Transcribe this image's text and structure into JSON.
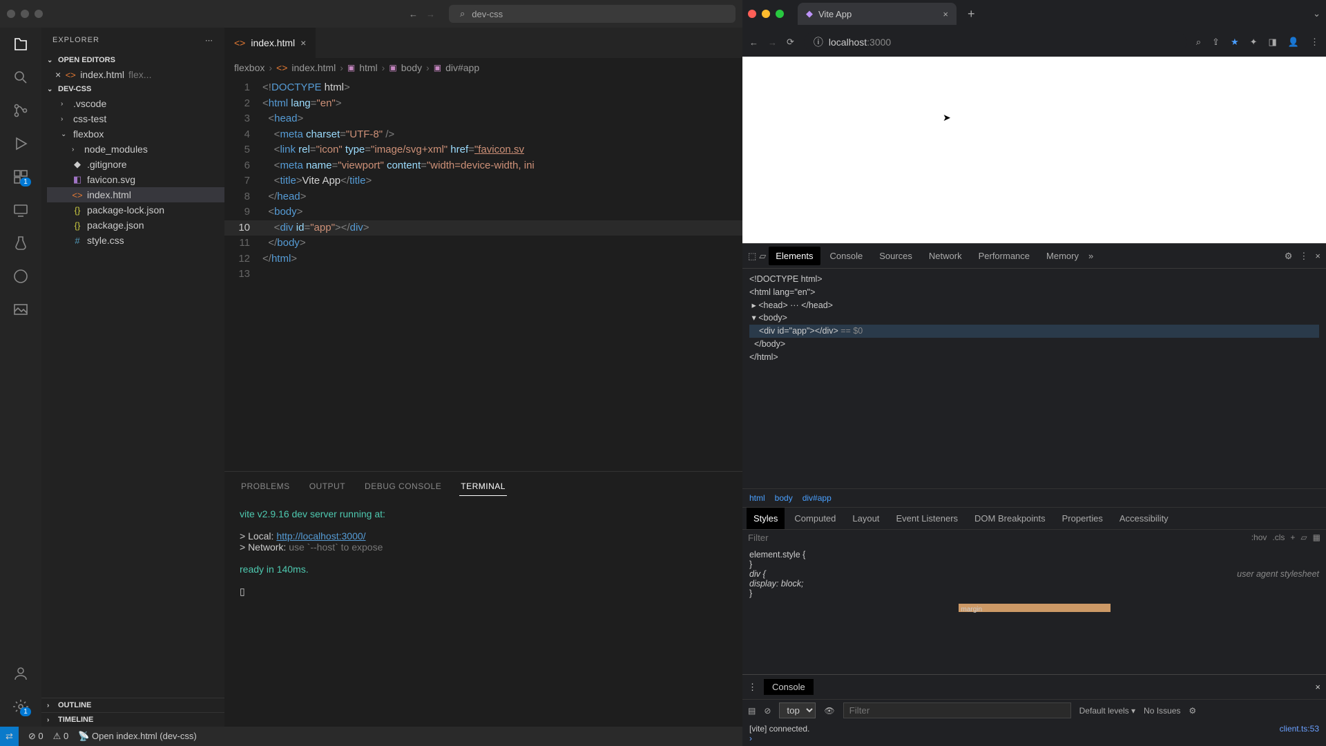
{
  "vscode": {
    "search_text": "dev-css",
    "explorer_title": "EXPLORER",
    "sections": {
      "open_editors": "OPEN EDITORS",
      "workspace": "DEV-CSS",
      "outline": "OUTLINE",
      "timeline": "TIMELINE"
    },
    "open_editor_file": "index.html",
    "open_editor_hint": "flex...",
    "tree": {
      "vscode_dir": ".vscode",
      "css_test": "css-test",
      "flexbox": "flexbox",
      "node_modules": "node_modules",
      "gitignore": ".gitignore",
      "favicon": "favicon.svg",
      "index": "index.html",
      "pkg_lock": "package-lock.json",
      "pkg": "package.json",
      "style": "style.css"
    },
    "tab_file": "index.html",
    "breadcrumb": {
      "a": "flexbox",
      "b": "index.html",
      "c": "html",
      "d": "body",
      "e": "div#app"
    },
    "code": {
      "l1a": "<!",
      "l1b": "DOCTYPE",
      "l1c": " html",
      "l1d": ">",
      "l2a": "<",
      "l2b": "html",
      "l2c": " lang",
      "l2d": "=",
      "l2e": "\"en\"",
      "l2f": ">",
      "l3a": "<",
      "l3b": "head",
      "l3c": ">",
      "l4a": "<",
      "l4b": "meta",
      "l4c": " charset",
      "l4d": "=",
      "l4e": "\"UTF-8\"",
      "l4f": " />",
      "l5a": "<",
      "l5b": "link",
      "l5c": " rel",
      "l5d": "=",
      "l5e": "\"icon\"",
      "l5f": " type",
      "l5g": "=",
      "l5h": "\"image/svg+xml\"",
      "l5i": " href",
      "l5j": "=",
      "l5k": "\"favicon.sv",
      "l6a": "<",
      "l6b": "meta",
      "l6c": " name",
      "l6d": "=",
      "l6e": "\"viewport\"",
      "l6f": " content",
      "l6g": "=",
      "l6h": "\"width=device-width, ini",
      "l7a": "<",
      "l7b": "title",
      "l7c": ">",
      "l7d": "Vite App",
      "l7e": "</",
      "l7f": "title",
      "l7g": ">",
      "l8a": "</",
      "l8b": "head",
      "l8c": ">",
      "l9a": "<",
      "l9b": "body",
      "l9c": ">",
      "l10a": "<",
      "l10b": "div",
      "l10c": " id",
      "l10d": "=",
      "l10e": "\"app\"",
      "l10f": "></",
      "l10g": "div",
      "l10h": ">",
      "l11a": "</",
      "l11b": "body",
      "l11c": ">",
      "l12a": "</",
      "l12b": "html",
      "l12c": ">"
    },
    "gutter": {
      "l1": "1",
      "l2": "2",
      "l3": "3",
      "l4": "4",
      "l5": "5",
      "l6": "6",
      "l7": "7",
      "l8": "8",
      "l9": "9",
      "l10": "10",
      "l11": "11",
      "l12": "12",
      "l13": "13"
    },
    "panel_tabs": {
      "problems": "PROBLEMS",
      "output": "OUTPUT",
      "debug": "DEBUG CONSOLE",
      "terminal": "TERMINAL"
    },
    "terminal": {
      "line1": "vite v2.9.16 dev server running at:",
      "local_label": "> Local:   ",
      "local_url": "http://localhost:3000/",
      "network": "> Network: ",
      "network_hint": "use `--host` to expose",
      "ready": "ready in 140ms.",
      "cursor": "▯"
    },
    "status": {
      "errors": "0",
      "warnings": "0",
      "live": "Open index.html (dev-css)"
    },
    "badge": "1"
  },
  "chrome": {
    "tab_title": "Vite App",
    "url_host": "localhost",
    "url_port": ":3000",
    "devtools_tabs": {
      "elements": "Elements",
      "console": "Console",
      "sources": "Sources",
      "network": "Network",
      "performance": "Performance",
      "memory": "Memory"
    },
    "dom": {
      "l1": "<!DOCTYPE html>",
      "l2": "<html lang=\"en\">",
      "l3": "<head> ··· </head>",
      "l4": "<body>",
      "l5": "<div id=\"app\"></div>",
      "l5b": " == $0",
      "l6": "</body>",
      "l7": "</html>"
    },
    "crumb": {
      "a": "html",
      "b": "body",
      "c": "div#app"
    },
    "styles_tabs": {
      "styles": "Styles",
      "computed": "Computed",
      "layout": "Layout",
      "listeners": "Event Listeners",
      "dombp": "DOM Breakpoints",
      "props": "Properties",
      "acc": "Accessibility"
    },
    "filter_ph": "Filter",
    "hov": ":hov",
    "cls": ".cls",
    "styles": {
      "el": "element.style {",
      "elc": "}",
      "div": "div {",
      "ua": "user agent stylesheet",
      "disp": "  display: block;",
      "divc": "}",
      "box_label": "margin"
    },
    "console": {
      "label": "Console",
      "top": "top",
      "filter_ph": "Filter",
      "levels": "Default levels",
      "issues": "No Issues",
      "msg": "[vite] connected.",
      "src": "client.ts:53",
      "prompt": "›"
    }
  }
}
